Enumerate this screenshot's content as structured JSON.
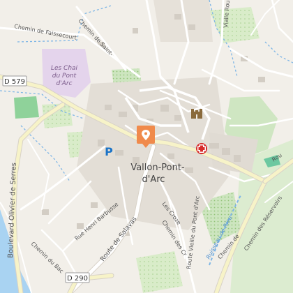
{
  "map": {
    "town_name_line1": "Vallon-Pont-",
    "town_name_line2": "d'Arc",
    "poi": {
      "lieu_line1": "Les Chai",
      "lieu_line2": "du Pont",
      "lieu_line3": "d'Arc"
    },
    "road_shields": {
      "d579": "D 579",
      "d290": "D 290"
    },
    "streets": {
      "faissecourte": "Chemin de Faissecourte",
      "saint_laurent": "Chemin de Saint-Laurent",
      "vialle": "Vialle Rou",
      "olivier_de_serres": "Boulevard Olivier de Serres",
      "henri_barbusse": "Rue Henri Barbusse",
      "salavas": "Route de Salavas",
      "crozes_rue": "Les Crozes",
      "crozes_chemin": "Chemin des Crozes",
      "vieille_pont": "Route Vieille du Pont d'Arc",
      "bac": "Chemin du Bac",
      "ruisseau": "Ruisseau de Rieu",
      "rieu_sud": "Chemin de Rieu",
      "reservoirs": "Chemin des Réservoirs",
      "right_edge": "Rou"
    },
    "parking_symbol": "P",
    "colors": {
      "background": "#f2efe9",
      "road_major": "#ffffff",
      "highway": "#f7f3c8",
      "forest": "#cfe6c2",
      "vineyard": "#d7eac7",
      "water": "#a9d3f2",
      "marker": "#f08a4b",
      "parking": "#1a73c7",
      "pharmacy": "#d62b2b",
      "castle": "#8a6a3b",
      "purple_area": "#e4d4ec"
    },
    "icons": [
      "location-marker-icon",
      "parking-icon",
      "pharmacy-icon",
      "castle-icon"
    ]
  }
}
